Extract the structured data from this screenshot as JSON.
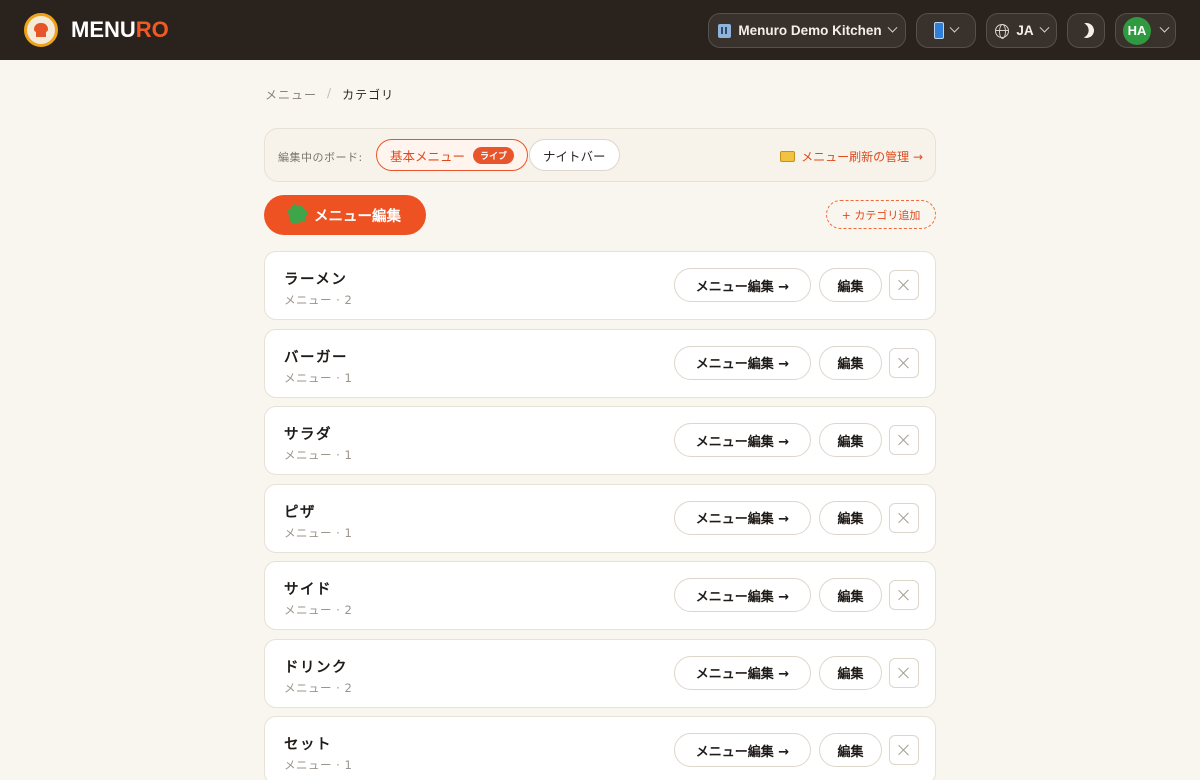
{
  "header": {
    "brand_part1": "MENU",
    "brand_part2": "RO",
    "restaurant": "Menuro Demo Kitchen",
    "language": "JA",
    "avatar_initials": "HA",
    "icons": [
      "chef-hat-icon",
      "building-icon",
      "mobile-phone-icon",
      "globe-icon",
      "moon-icon"
    ]
  },
  "breadcrumb": {
    "parent": "メニュー",
    "separator": "/",
    "current": "カテゴリ"
  },
  "board_selector": {
    "label": "編集中のボード:",
    "boards": [
      {
        "label": "基本メニュー",
        "badge": "ライブ",
        "active": true
      },
      {
        "label": "ナイトバー",
        "active": false
      }
    ],
    "refresh_link": "メニュー刷新の管理 →"
  },
  "actions": {
    "edit_menu": "メニュー編集",
    "add_category": "+ カテゴリ追加"
  },
  "categories": [
    {
      "name": "ラーメン",
      "count": "メニュー · 2",
      "menu_edit": "メニュー編集 →",
      "edit": "編集"
    },
    {
      "name": "バーガー",
      "count": "メニュー · 1",
      "menu_edit": "メニュー編集 →",
      "edit": "編集"
    },
    {
      "name": "サラダ",
      "count": "メニュー · 1",
      "menu_edit": "メニュー編集 →",
      "edit": "編集"
    },
    {
      "name": "ピザ",
      "count": "メニュー · 1",
      "menu_edit": "メニュー編集 →",
      "edit": "編集"
    },
    {
      "name": "サイド",
      "count": "メニュー · 2",
      "menu_edit": "メニュー編集 →",
      "edit": "編集"
    },
    {
      "name": "ドリンク",
      "count": "メニュー · 2",
      "menu_edit": "メニュー編集 →",
      "edit": "編集"
    },
    {
      "name": "セット",
      "count": "メニュー · 1",
      "menu_edit": "メニュー編集 →",
      "edit": "編集"
    }
  ],
  "colors": {
    "accent": "#ee5223",
    "header_bg": "#2a221d",
    "page_bg": "#f9f6ef",
    "avatar_bg": "#2f9a3f"
  }
}
